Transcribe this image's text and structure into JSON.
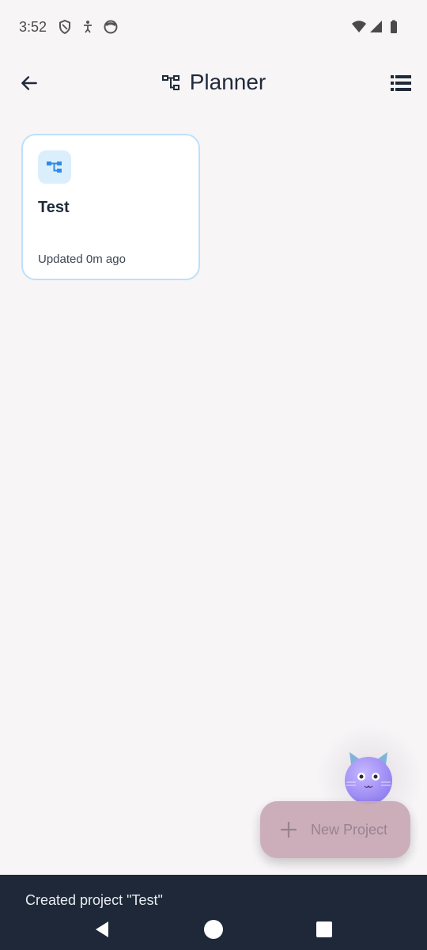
{
  "status_bar": {
    "time": "3:52",
    "left_icons": [
      "shield-icon",
      "accessibility-icon",
      "record-icon"
    ],
    "right_icons": [
      "wifi-icon",
      "signal-icon",
      "battery-icon"
    ]
  },
  "app_bar": {
    "title": "Planner",
    "title_icon": "project-tree-icon",
    "back_icon": "arrow-left-icon",
    "view_toggle_icon": "list-view-icon"
  },
  "projects": [
    {
      "name": "Test",
      "updated": "Updated 0m ago",
      "icon": "project-tree-icon"
    }
  ],
  "fab": {
    "label": "New Project",
    "icon": "plus-icon",
    "color": "#c9a9b5"
  },
  "mascot": {
    "icon": "cat-mascot-icon",
    "color": "#9b8cf0"
  },
  "snackbar": {
    "message": "Created project \"Test\""
  },
  "nav_bar": {
    "buttons": [
      "back-triangle-icon",
      "home-circle-icon",
      "recents-square-icon"
    ]
  },
  "colors": {
    "background": "#f8f5f7",
    "card_border": "#bde0fb",
    "accent_blue": "#2f8ce6",
    "snackbar_bg": "#1e2838"
  }
}
